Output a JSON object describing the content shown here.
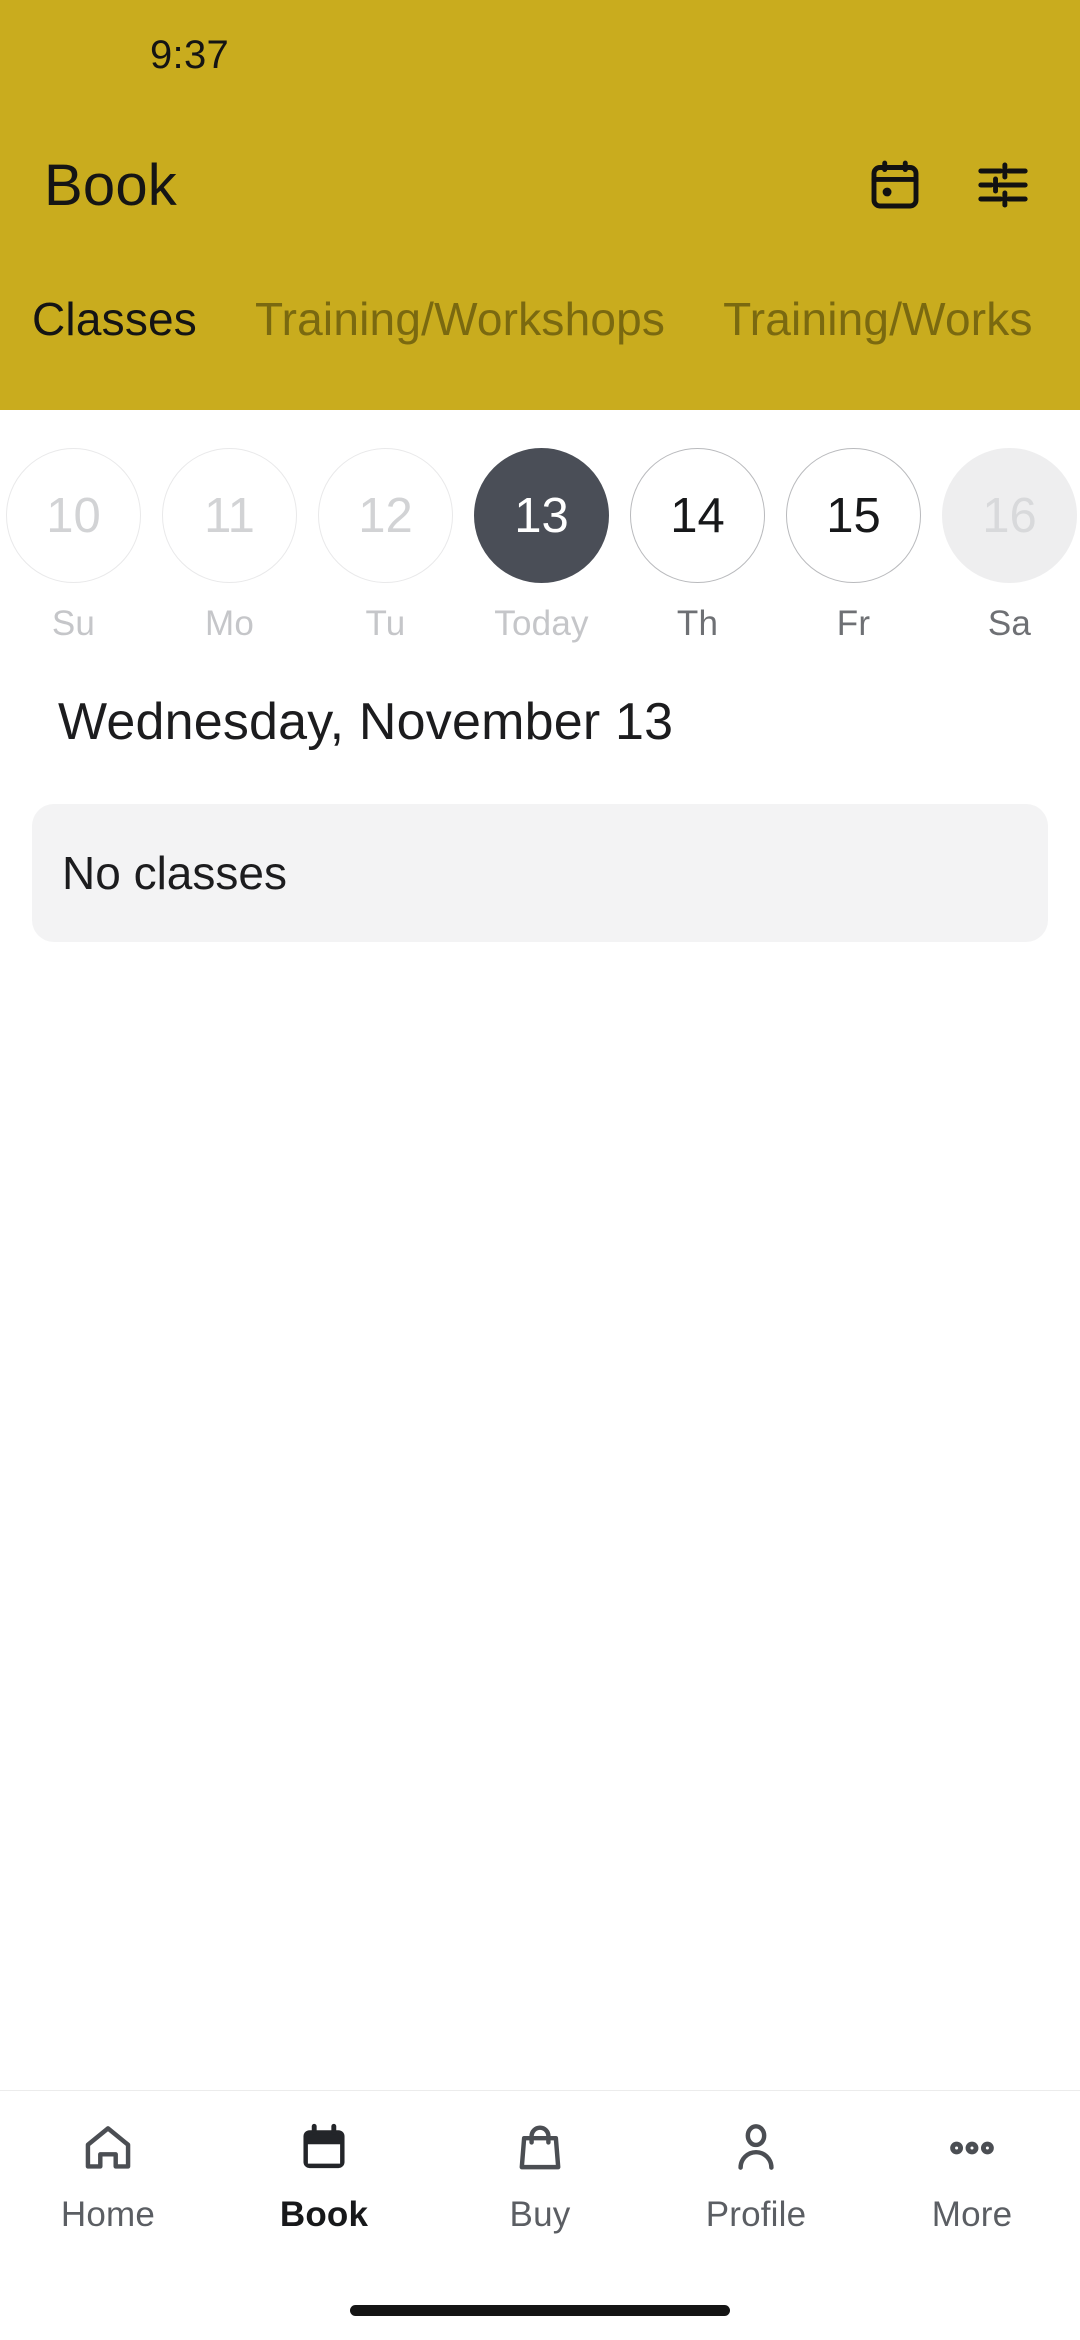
{
  "theme": {
    "header_bg": "#c9ac1e",
    "selected_day_bg": "#4a4e57",
    "card_bg": "#f3f3f4",
    "page_bg": "#ffffff"
  },
  "status_bar": {
    "time": "9:37"
  },
  "app_bar": {
    "title": "Book",
    "actions": [
      {
        "name": "calendar-icon",
        "label": "Calendar"
      },
      {
        "name": "filter-icon",
        "label": "Filters"
      }
    ]
  },
  "tabs": [
    {
      "label": "Classes",
      "active": true
    },
    {
      "label": "Training/Workshops",
      "active": false
    },
    {
      "label": "Training/Works",
      "active": false
    }
  ],
  "date_strip": [
    {
      "day": "10",
      "label": "Su",
      "state": "past"
    },
    {
      "day": "11",
      "label": "Mo",
      "state": "past"
    },
    {
      "day": "12",
      "label": "Tu",
      "state": "past"
    },
    {
      "day": "13",
      "label": "Today",
      "state": "selected"
    },
    {
      "day": "14",
      "label": "Th",
      "state": "available"
    },
    {
      "day": "15",
      "label": "Fr",
      "state": "available"
    },
    {
      "day": "16",
      "label": "Sa",
      "state": "unavailable"
    }
  ],
  "content": {
    "day_heading": "Wednesday, November 13",
    "empty_state": "No classes"
  },
  "bottom_nav": [
    {
      "label": "Home",
      "icon": "home-icon",
      "active": false
    },
    {
      "label": "Book",
      "icon": "calendar-icon",
      "active": true
    },
    {
      "label": "Buy",
      "icon": "bag-icon",
      "active": false
    },
    {
      "label": "Profile",
      "icon": "person-icon",
      "active": false
    },
    {
      "label": "More",
      "icon": "dots-icon",
      "active": false
    }
  ]
}
